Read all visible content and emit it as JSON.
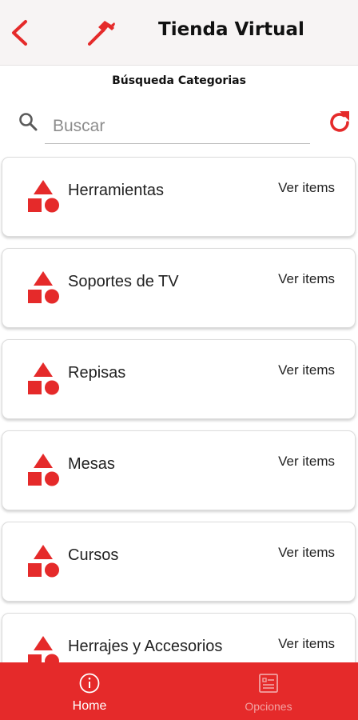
{
  "header": {
    "title": "Tienda Virtual",
    "back_icon": "chevron-left-icon",
    "logo_icon": "hammer-icon"
  },
  "section": {
    "title": "Búsqueda Categorias"
  },
  "search": {
    "placeholder": "Buscar",
    "value": "",
    "icon": "search-icon",
    "refresh_icon": "refresh-icon"
  },
  "categories": [
    {
      "name": "Herramientas",
      "action": "Ver items",
      "icon": "shapes-icon"
    },
    {
      "name": "Soportes de TV",
      "action": "Ver items",
      "icon": "shapes-icon"
    },
    {
      "name": "Repisas",
      "action": "Ver items",
      "icon": "shapes-icon"
    },
    {
      "name": "Mesas",
      "action": "Ver items",
      "icon": "shapes-icon"
    },
    {
      "name": "Cursos",
      "action": "Ver items",
      "icon": "shapes-icon"
    },
    {
      "name": "Herrajes y Accesorios",
      "action": "Ver items",
      "icon": "shapes-icon"
    }
  ],
  "bottom_nav": {
    "items": [
      {
        "label": "Home",
        "icon": "info-icon",
        "active": true
      },
      {
        "label": "Opciones",
        "icon": "list-icon",
        "active": false
      }
    ]
  },
  "colors": {
    "accent": "#e52a2a",
    "header_bg": "#f7f4f4",
    "inactive_nav": "#f2a2a2"
  }
}
